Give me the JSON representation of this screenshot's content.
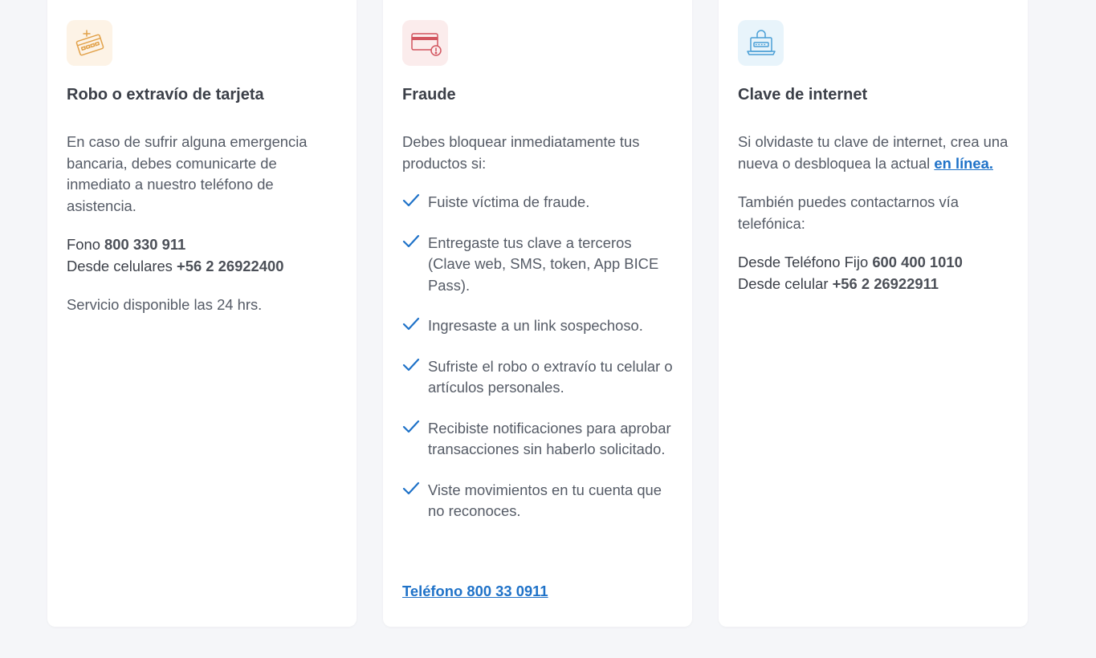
{
  "colors": {
    "page_bg": "#f5f6f9",
    "card_bg": "#ffffff",
    "link": "#1f72c8",
    "check": "#1f72c8",
    "card_icon_orange": "#e2a24a",
    "card_icon_red": "#d2555f",
    "card_icon_blue": "#4a9fd6"
  },
  "card1": {
    "icon": "card-scissors-icon",
    "title": "Robo o extravío de tarjeta",
    "intro": "En caso de sufrir alguna emergencia bancaria, debes comunicarte de inmediato a nuestro teléfono de asistencia.",
    "fono_label": "Fono ",
    "fono_number": "800 330 911",
    "cel_label": "Desde celulares ",
    "cel_number": "+56 2 26922400",
    "service": "Servicio disponible las 24 hrs."
  },
  "card2": {
    "icon": "card-alert-icon",
    "title": "Fraude",
    "intro": "Debes bloquear inmediatamente tus productos si:",
    "items": [
      "Fuiste víctima de fraude.",
      "Entregaste tus clave a terceros (Clave web, SMS, token, App BICE Pass).",
      "Ingresaste a un link sospechoso.",
      "Sufriste el robo o extravío tu celular o artículos personales.",
      "Recibiste notificaciones para aprobar transacciones sin haberlo solicitado.",
      "Viste movimientos en tu cuenta que no reconoces."
    ],
    "phone_link": "Teléfono 800 33 0911"
  },
  "card3": {
    "icon": "laptop-lock-icon",
    "title": "Clave de internet",
    "intro": "Si olvidaste tu clave de internet, crea una nueva o desbloquea la actual ",
    "intro_link": "en línea.",
    "contact": "También puedes contactarnos vía telefónica:",
    "fijo_label": "Desde Teléfono Fijo ",
    "fijo_number": "600 400 1010",
    "cel_label": "Desde celular ",
    "cel_number": "+56 2 26922911"
  }
}
